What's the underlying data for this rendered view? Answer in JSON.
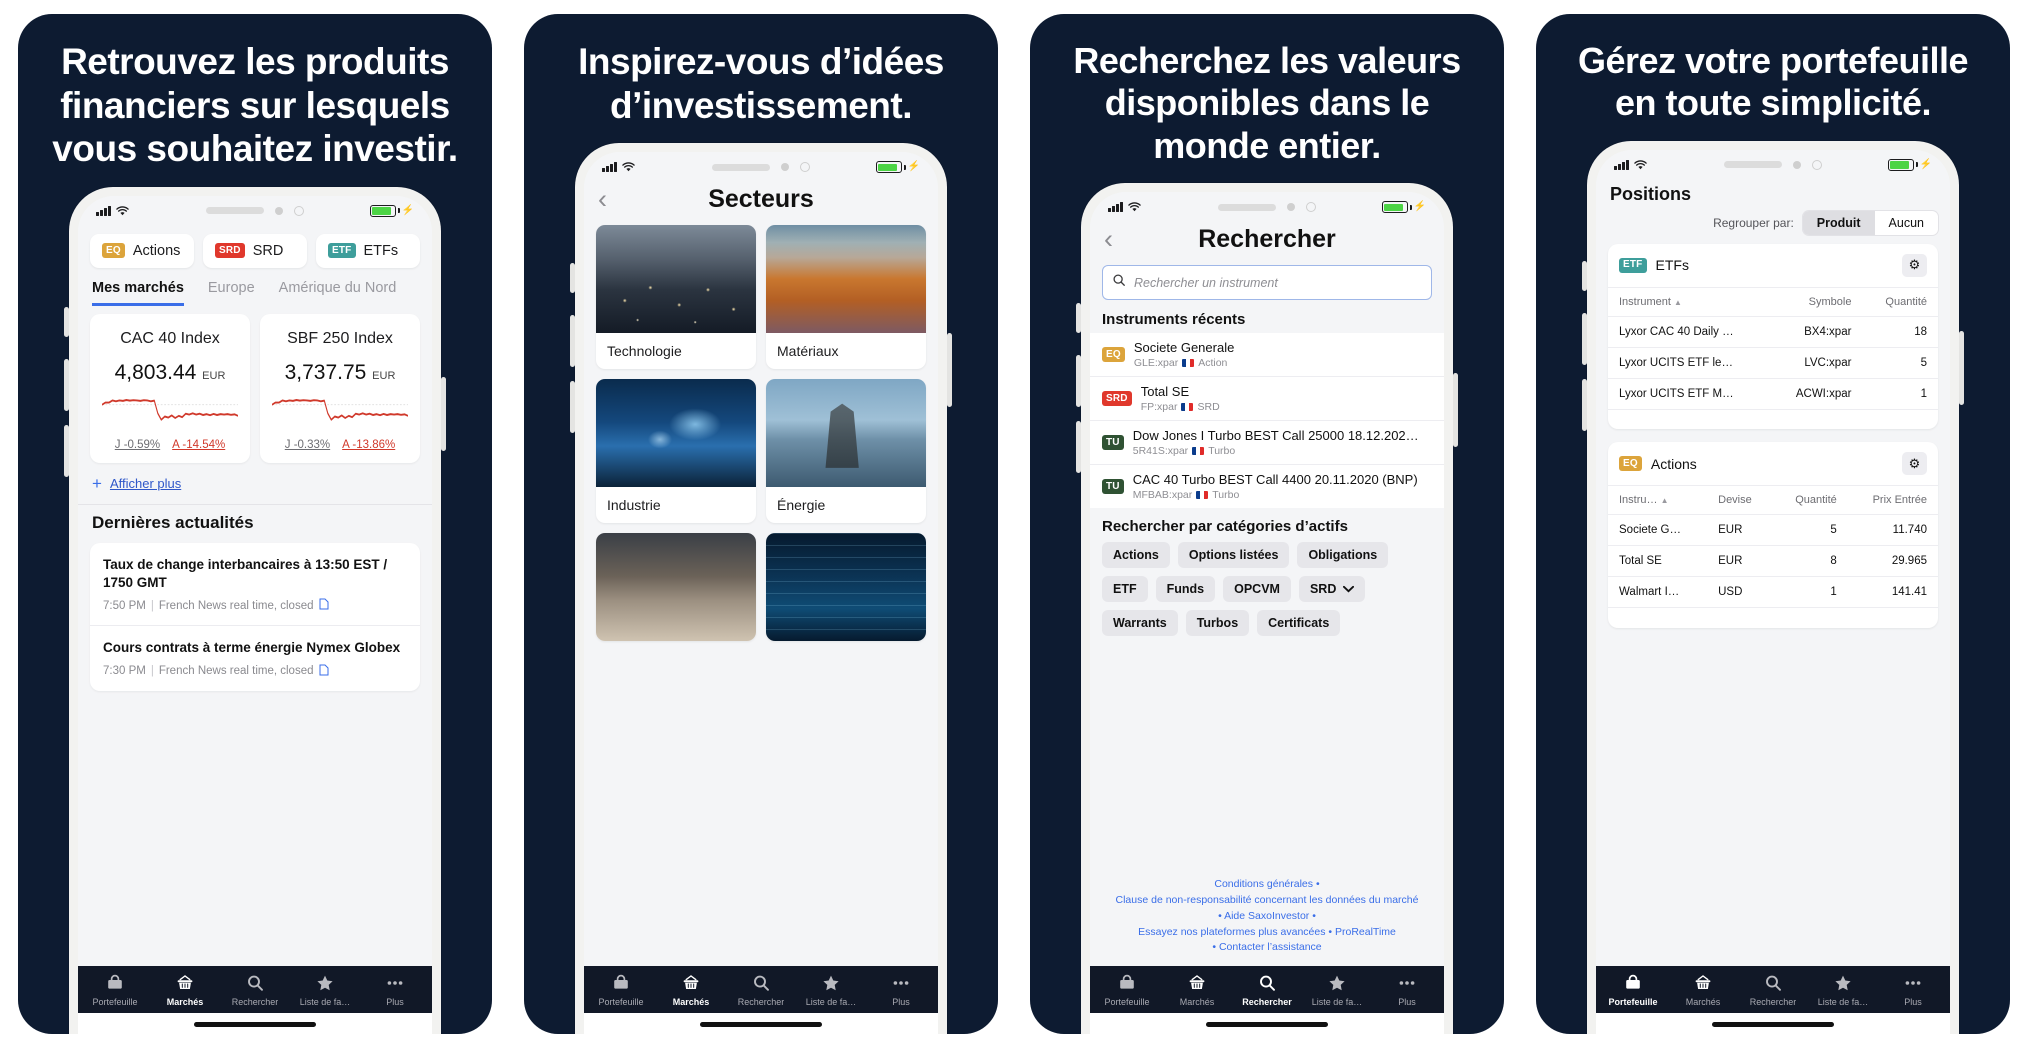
{
  "panels": [
    {
      "headline": "Retrouvez les produits financiers sur lesquels vous souhaitez investir.",
      "screen": "markets"
    },
    {
      "headline": "Inspirez-vous d’idées d’investissement.",
      "screen": "sectors"
    },
    {
      "headline": "Recherchez les valeurs disponibles dans le monde entier.",
      "screen": "search"
    },
    {
      "headline": "Gérez votre portefeuille en toute simplicité.",
      "screen": "positions"
    }
  ],
  "markets": {
    "categories": [
      {
        "tag": "EQ",
        "label": "Actions"
      },
      {
        "tag": "SRD",
        "label": "SRD"
      },
      {
        "tag": "ETF",
        "label": "ETFs"
      }
    ],
    "tabs": [
      {
        "label": "Mes marchés",
        "active": true
      },
      {
        "label": "Europe",
        "active": false
      },
      {
        "label": "Amérique du Nord",
        "active": false
      }
    ],
    "indices": [
      {
        "name": "CAC 40 Index",
        "value": "4,803.44",
        "currency": "EUR",
        "day_label": "J",
        "day_change": "-0.59%",
        "year_label": "A",
        "year_change": "-14.54%"
      },
      {
        "name": "SBF 250 Index",
        "value": "3,737.75",
        "currency": "EUR",
        "day_label": "J",
        "day_change": "-0.33%",
        "year_label": "A",
        "year_change": "-13.86%"
      }
    ],
    "show_more": "Afficher plus",
    "news_title": "Dernières actualités",
    "news": [
      {
        "headline": "Taux de change interbancaires à 13:50 EST / 1750 GMT",
        "time": "7:50 PM",
        "source": "French News real time, closed"
      },
      {
        "headline": "Cours contrats à terme énergie Nymex Globex",
        "time": "7:30 PM",
        "source": "French News real time, closed"
      }
    ]
  },
  "sectors": {
    "title": "Secteurs",
    "items": [
      {
        "label": "Technologie",
        "img": "img-tech"
      },
      {
        "label": "Matériaux",
        "img": "img-mat"
      },
      {
        "label": "Industrie",
        "img": "img-ind"
      },
      {
        "label": "Énergie",
        "img": "img-ene"
      },
      {
        "label": "",
        "img": "img-cons"
      },
      {
        "label": "",
        "img": "img-fin"
      }
    ]
  },
  "search": {
    "title": "Rechercher",
    "placeholder": "Rechercher un instrument",
    "value": "",
    "recent_title": "Instruments récents",
    "recent": [
      {
        "tag": "EQ",
        "name": "Societe Generale",
        "symbol": "GLE:xpar",
        "type": "Action"
      },
      {
        "tag": "SRD",
        "name": "Total SE",
        "symbol": "FP:xpar",
        "type": "SRD"
      },
      {
        "tag": "TU",
        "name": "Dow Jones I Turbo BEST Call 25000 18.12.202…",
        "symbol": "5R41S:xpar",
        "type": "Turbo"
      },
      {
        "tag": "TU",
        "name": "CAC 40 Turbo BEST Call 4400 20.11.2020 (BNP)",
        "symbol": "MFBAB:xpar",
        "type": "Turbo"
      }
    ],
    "categories_title": "Rechercher par catégories d’actifs",
    "chips": [
      {
        "label": "Actions",
        "dropdown": false
      },
      {
        "label": "Options listées",
        "dropdown": false
      },
      {
        "label": "Obligations",
        "dropdown": false
      },
      {
        "label": "ETF",
        "dropdown": false
      },
      {
        "label": "Funds",
        "dropdown": false
      },
      {
        "label": "OPCVM",
        "dropdown": false
      },
      {
        "label": "SRD",
        "dropdown": true
      },
      {
        "label": "Warrants",
        "dropdown": false
      },
      {
        "label": "Turbos",
        "dropdown": false
      },
      {
        "label": "Certificats",
        "dropdown": false
      }
    ],
    "footer": {
      "l1": "Conditions générales",
      "l2": "Clause de non-responsabilité concernant les données du marché",
      "l3": "Aide SaxoInvestor",
      "l4": "Essayez nos plateformes plus avancées",
      "l5": "ProRealTime",
      "l6": "Contacter l’assistance"
    }
  },
  "positions": {
    "title": "Positions",
    "group_label": "Regrouper par:",
    "group_options": [
      {
        "label": "Produit",
        "selected": true
      },
      {
        "label": "Aucun",
        "selected": false
      }
    ],
    "groups": [
      {
        "tag": "ETF",
        "title": "ETFs",
        "columns": [
          "Instrument",
          "Symbole",
          "Quantité"
        ],
        "sort_column": 0,
        "rows": [
          [
            "Lyxor CAC 40 Daily …",
            "BX4:xpar",
            "18"
          ],
          [
            "Lyxor UCITS ETF le…",
            "LVC:xpar",
            "5"
          ],
          [
            "Lyxor UCITS ETF M…",
            "ACWI:xpar",
            "1"
          ]
        ]
      },
      {
        "tag": "EQ",
        "title": "Actions",
        "columns": [
          "Instru…",
          "Devise",
          "Quantité",
          "Prix Entrée"
        ],
        "sort_column": 0,
        "rows": [
          [
            "Societe G…",
            "EUR",
            "5",
            "11.740"
          ],
          [
            "Total SE",
            "EUR",
            "8",
            "29.965"
          ],
          [
            "Walmart I…",
            "USD",
            "1",
            "141.41"
          ]
        ]
      }
    ]
  },
  "tabbar": {
    "items": [
      {
        "label": "Portefeuille",
        "icon": "briefcase-icon"
      },
      {
        "label": "Marchés",
        "icon": "basket-icon"
      },
      {
        "label": "Rechercher",
        "icon": "search-icon"
      },
      {
        "label": "Liste de fa…",
        "icon": "star-icon"
      },
      {
        "label": "Plus",
        "icon": "more-icon"
      }
    ],
    "active_per_panel": [
      1,
      1,
      2,
      0
    ]
  },
  "colors": {
    "panel_bg": "#0d1b31",
    "accent_blue": "#3a6ee8",
    "tag_eq": "#dca43b",
    "tag_srd": "#e0382c",
    "tag_etf": "#3e9e9b",
    "tag_turbo": "#2f5233",
    "down_red": "#d0392b",
    "tabbar_bg": "#111827"
  }
}
